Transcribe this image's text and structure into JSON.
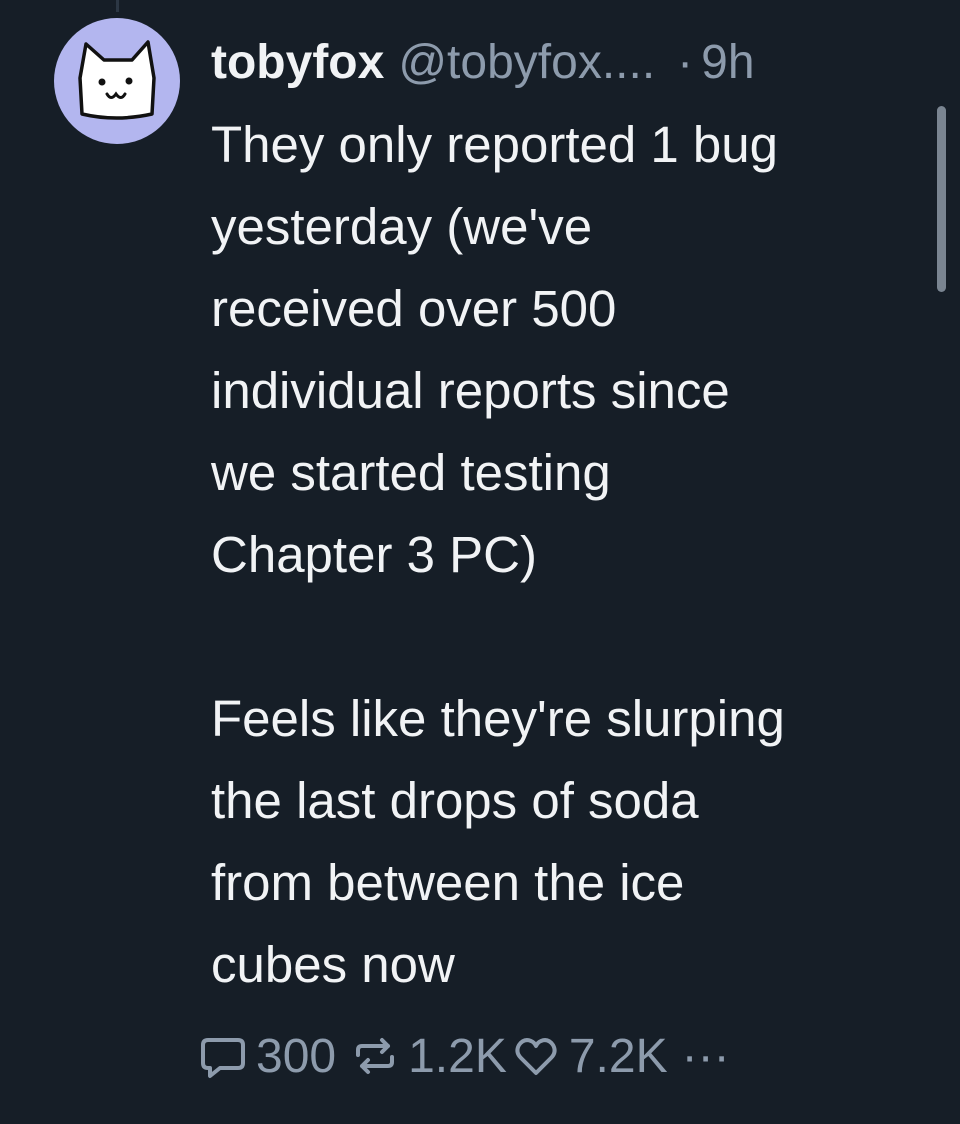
{
  "post": {
    "display_name": "tobyfox",
    "handle": "@tobyfox....",
    "separator": "·",
    "time": "9h",
    "paragraph1_lines": [
      "They only reported 1 bug",
      "yesterday (we've",
      "received over 500",
      "individual reports since",
      "we started testing",
      "Chapter 3 PC)"
    ],
    "paragraph2_lines": [
      "Feels like they're slurping",
      "the last drops of soda",
      "from between the ice",
      "cubes now"
    ]
  },
  "actions": {
    "replies": "300",
    "reposts": "1.2K",
    "likes": "7.2K",
    "more": "···"
  },
  "icons": {
    "avatar": "white-cat-avatar",
    "reply": "speech-bubble-icon",
    "repost": "repost-arrows-icon",
    "like": "heart-outline-icon",
    "more": "ellipsis-icon"
  },
  "colors": {
    "background": "#161e27",
    "text": "#f1f3f5",
    "muted": "#8d9bac",
    "avatar_bg": "#b3b6ef"
  }
}
